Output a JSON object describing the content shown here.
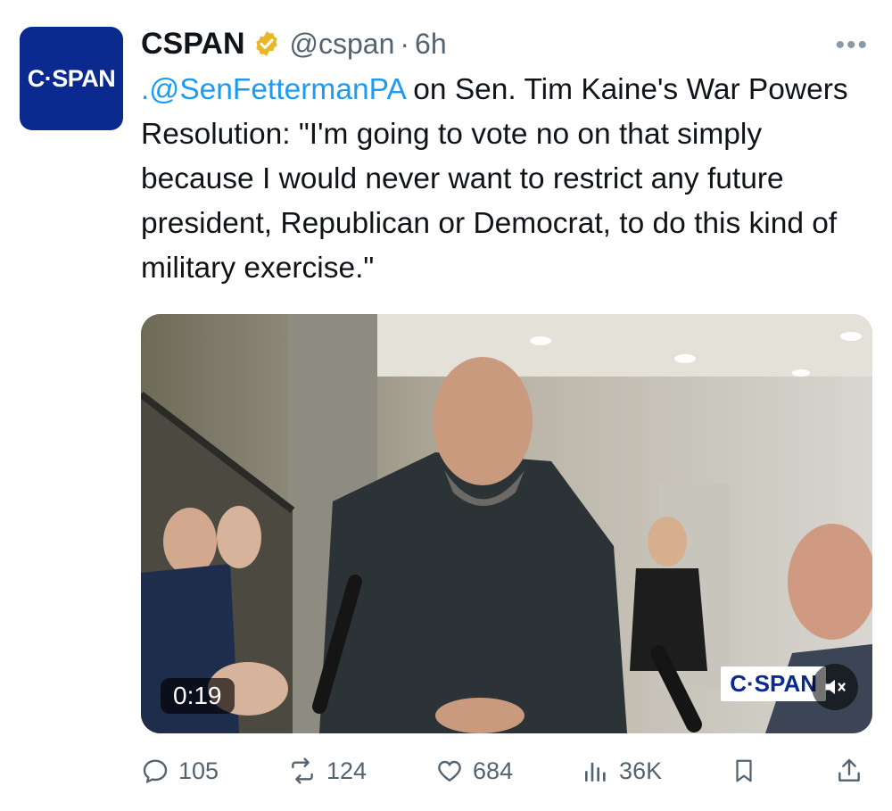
{
  "author": {
    "avatar_text": "C·SPAN",
    "name": "CSPAN",
    "handle": "@cspan",
    "separator": "·",
    "time": "6h",
    "verified_badge_icon": "gold-verified-badge-icon",
    "more_icon": "more-options-icon"
  },
  "tweet": {
    "mention": ".@SenFettermanPA",
    "text": " on Sen. Tim Kaine's War Powers Resolution: \"I'm going to vote no on that simply because I would never want to restrict any future president, Republican or Democrat, to do this kind of military exercise.\""
  },
  "media": {
    "duration": "0:19",
    "watermark": "C·SPAN",
    "mute_icon": "muted-speaker-icon"
  },
  "actions": {
    "replies": "105",
    "reposts": "124",
    "likes": "684",
    "views": "36K"
  },
  "colors": {
    "brand_blue": "#0b2a8f",
    "link": "#1d9bf0",
    "verified_gold": "#e8b829",
    "secondary_text": "#536471"
  }
}
